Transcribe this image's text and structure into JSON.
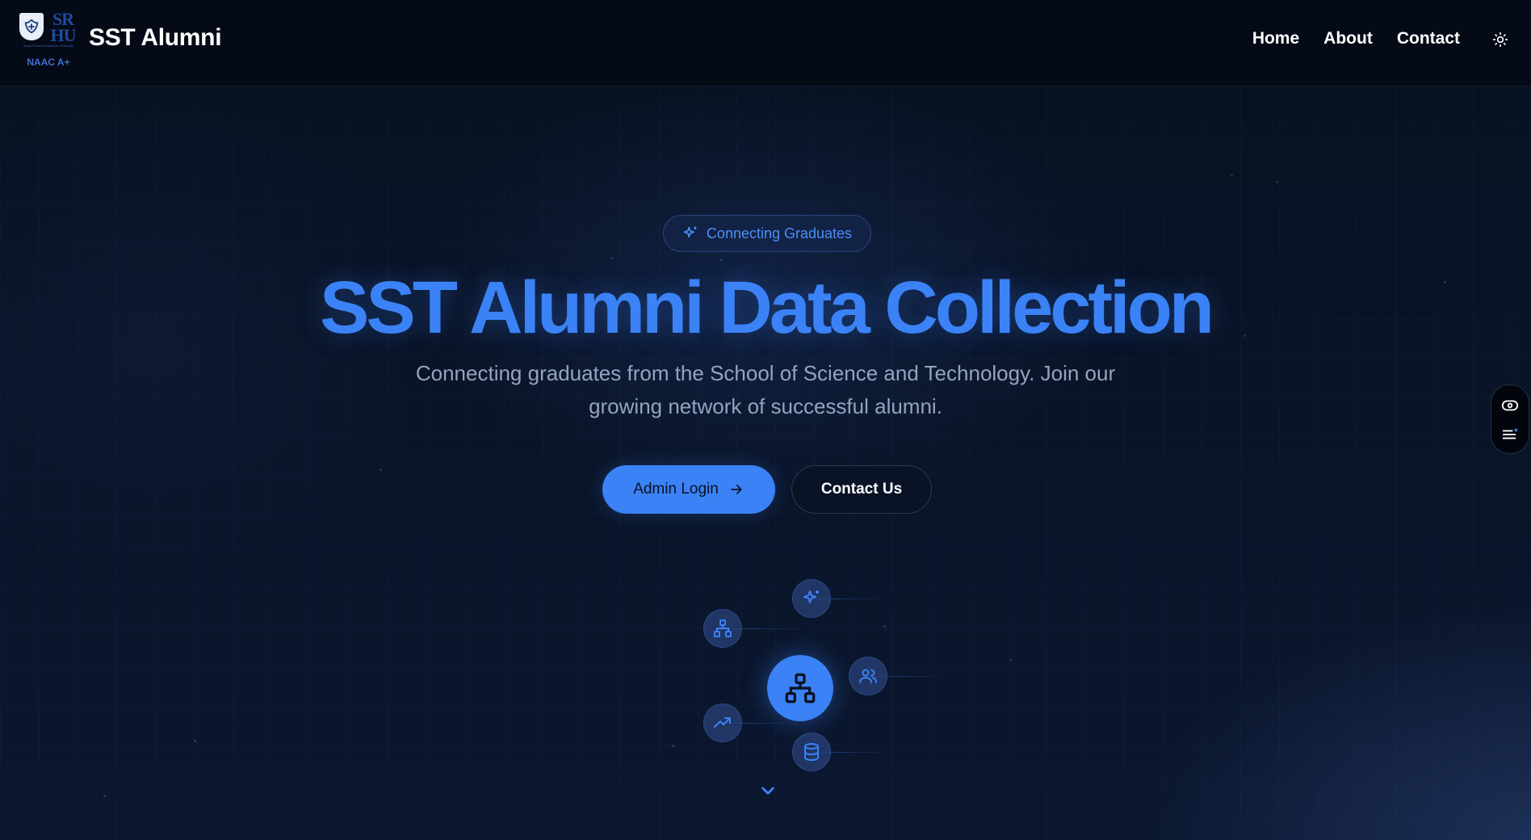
{
  "header": {
    "logo": {
      "letters": "SR HU",
      "tagline": "Swami Rama Himalayan University",
      "accreditation": "NAAC A+"
    },
    "brand": "SST Alumni",
    "nav": [
      {
        "label": "Home"
      },
      {
        "label": "About"
      },
      {
        "label": "Contact"
      }
    ],
    "theme_toggle_icon": "sun-icon"
  },
  "hero": {
    "badge": {
      "icon": "sparkles-icon",
      "label": "Connecting Graduates"
    },
    "title": "SST Alumni Data Collection",
    "subtitle": "Connecting graduates from the School of Science and Technology. Join our growing network of successful alumni.",
    "primary_button": {
      "label": "Admin Login",
      "icon": "arrow-right-icon"
    },
    "secondary_button": {
      "label": "Contact Us"
    }
  },
  "illustration": {
    "center_icon": "network-icon",
    "nodes": [
      "sparkles-icon",
      "network-icon",
      "users-icon",
      "trending-up-icon",
      "database-icon"
    ],
    "scroll_icon": "chevron-down-icon"
  },
  "side_widget": {
    "icons": [
      "eye-icon",
      "menu-icon"
    ]
  },
  "colors": {
    "accent": "#3b82f6",
    "background": "#070d1c",
    "header": "#050a17",
    "subtitle": "#94a3bf"
  }
}
